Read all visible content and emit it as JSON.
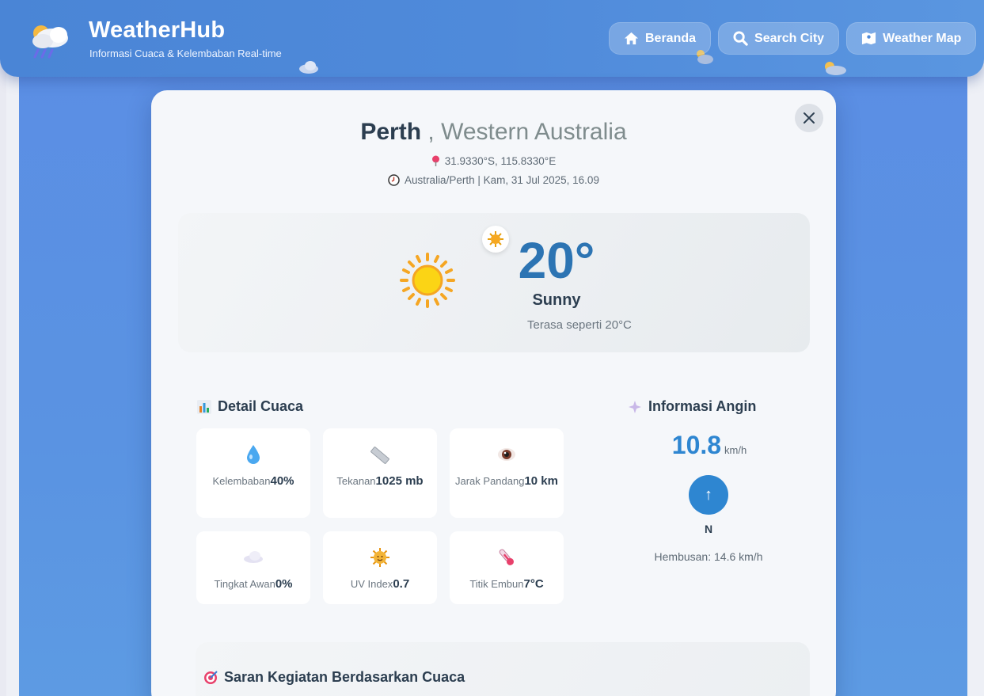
{
  "header": {
    "brand_title": "WeatherHub",
    "brand_subtitle": "Informasi Cuaca & Kelembaban Real-time",
    "logo_icon": "cloud-rain-sun-icon",
    "nav": [
      {
        "label": "Beranda",
        "icon": "home-icon"
      },
      {
        "label": "Search City",
        "icon": "search-icon"
      },
      {
        "label": "Weather Map",
        "icon": "map-icon"
      }
    ]
  },
  "location": {
    "city": "Perth",
    "separator": ",",
    "region": "Western Australia",
    "coordinates": "31.9330°S, 115.8330°E",
    "timezone_line": "Australia/Perth | Kam, 31 Jul 2025, 16.09"
  },
  "current": {
    "temperature": "20°",
    "condition": "Sunny",
    "feels_like": "Terasa seperti 20°C",
    "icon": "sun-icon"
  },
  "details": {
    "title": "Detail Cuaca",
    "items": [
      {
        "label": "Kelembaban",
        "value": "40%",
        "icon": "droplet-icon"
      },
      {
        "label": "Tekanan",
        "value": "1025 mb",
        "icon": "ruler-icon"
      },
      {
        "label": "Jarak Pandang",
        "value": "10 km",
        "icon": "eye-icon"
      },
      {
        "label": "Tingkat Awan",
        "value": "0%",
        "icon": "cloud-icon"
      },
      {
        "label": "UV Index",
        "value": "0.7",
        "icon": "sun-face-icon"
      },
      {
        "label": "Titik Embun",
        "value": "7°C",
        "icon": "thermometer-icon"
      }
    ]
  },
  "wind": {
    "title": "Informasi Angin",
    "speed": "10.8",
    "unit": "km/h",
    "arrow": "↑",
    "direction": "N",
    "gust": "Hembusan: 14.6 km/h"
  },
  "suggestions": {
    "title": "Saran Kegiatan Berdasarkan Cuaca"
  },
  "colors": {
    "accent": "#2e86d1",
    "header": "#4a85d6",
    "text_dark": "#2c3e50"
  }
}
